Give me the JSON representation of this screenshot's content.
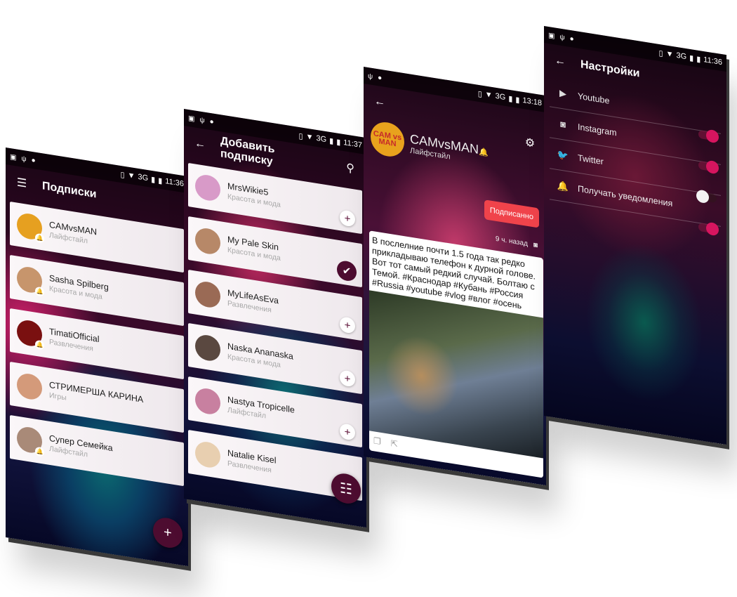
{
  "screens": {
    "subscriptions": {
      "status": {
        "time": "11:36",
        "network": "3G"
      },
      "title": "Подписки",
      "menu_icon": "hamburger-menu-icon",
      "items": [
        {
          "name": "CAMvsMAN",
          "category": "Лайфстайл"
        },
        {
          "name": "Sasha Spilberg",
          "category": "Красота и мода"
        },
        {
          "name": "TimatiOfficial",
          "category": "Развлечения"
        },
        {
          "name": "СТРИМЕРША КАРИНА",
          "category": "Игры"
        },
        {
          "name": "Супер Семейка",
          "category": "Лайфстайл"
        }
      ],
      "fab_label": "+"
    },
    "add_subscription": {
      "status": {
        "time": "11:37",
        "network": "3G"
      },
      "title": "Добавить подписку",
      "items": [
        {
          "name": "MrsWikie5",
          "category": "Красота и мода",
          "subscribed": false
        },
        {
          "name": "My Pale Skin",
          "category": "Красота и мода",
          "subscribed": true
        },
        {
          "name": "MyLifeAsEva",
          "category": "Развлечения",
          "subscribed": false
        },
        {
          "name": "Naska Ananaska",
          "category": "Красота и мода",
          "subscribed": false
        },
        {
          "name": "Nastya Tropicelle",
          "category": "Лайфстайл",
          "subscribed": false
        },
        {
          "name": "Natalie Kisel",
          "category": "Развлечения",
          "subscribed": false
        }
      ]
    },
    "channel": {
      "status": {
        "time": "13:18",
        "network": "3G"
      },
      "channel_name": "CAMvsMAN",
      "avatar_text": "CAM vs MAN",
      "category": "Лайфстайл",
      "subscribe_button": "Подписанно",
      "post": {
        "time_ago": "9 ч. назад",
        "source": "instagram",
        "text": "В послелние почти 1.5 года так редко прикладываю телефон к дурной голове. Вот тот самый редкий случай. Болтаю с Темой. #Краснодар #Кубань #Россия #Russia #youtube #vlog #влог #осень"
      }
    },
    "settings": {
      "status": {
        "time": "11:36",
        "network": "3G"
      },
      "title": "Настройки",
      "rows": [
        {
          "label": "Youtube",
          "icon": "youtube-icon",
          "enabled": true
        },
        {
          "label": "Instagram",
          "icon": "instagram-icon",
          "enabled": true
        },
        {
          "label": "Twitter",
          "icon": "twitter-icon",
          "enabled": false
        },
        {
          "label": "Получать уведомления",
          "icon": "bell-icon",
          "enabled": true
        }
      ]
    }
  }
}
